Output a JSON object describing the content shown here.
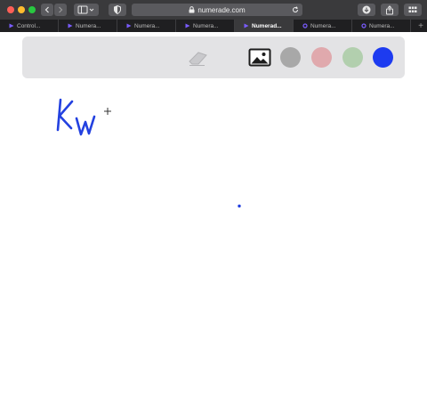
{
  "browser": {
    "url": "numerade.com",
    "tabs": [
      {
        "label": "Control..."
      },
      {
        "label": "Numera..."
      },
      {
        "label": "Numera..."
      },
      {
        "label": "Numera..."
      },
      {
        "label": "Numerad..."
      },
      {
        "label": "Numera..."
      },
      {
        "label": "Numera..."
      }
    ],
    "active_tab_index": 4,
    "new_tab_label": "+"
  },
  "toolbar": {
    "colors": {
      "gray": "#a8a8a8",
      "pink": "#e0a9ad",
      "green": "#b2cfae",
      "blue": "#1d3bf0"
    },
    "selected_color": "blue"
  },
  "canvas": {
    "handwriting": "Kw",
    "ink_color": "#2341e0"
  }
}
